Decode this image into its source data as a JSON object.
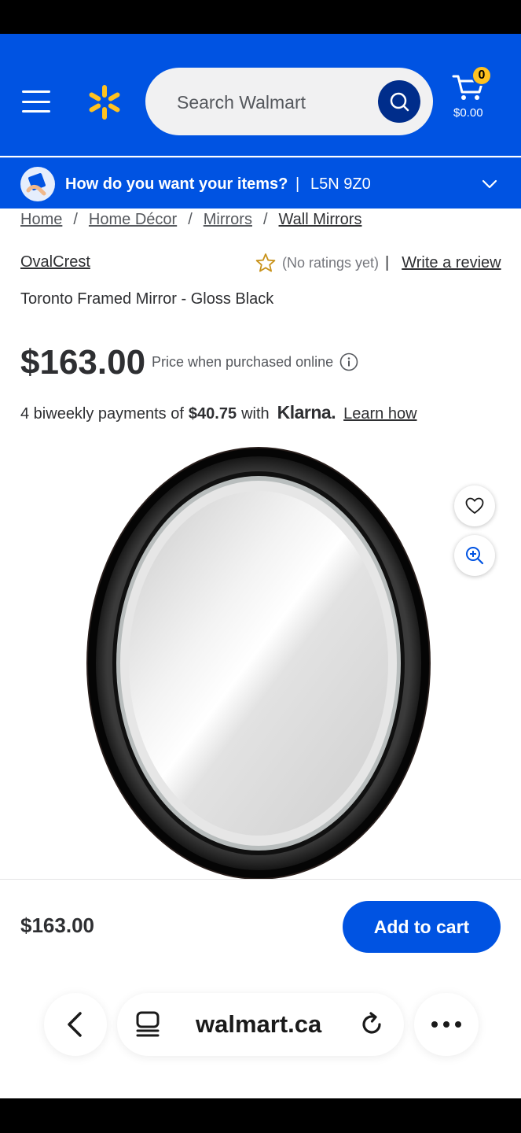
{
  "header": {
    "search_placeholder": "Search Walmart",
    "cart_count": "0",
    "cart_total": "$0.00",
    "brand_color": "#0053e2",
    "spark_color": "#ffc220"
  },
  "delivery": {
    "question": "How do you want your items?",
    "separator": "|",
    "postal_code": "L5N 9Z0"
  },
  "breadcrumb": {
    "items": [
      "Home",
      "Home Décor",
      "Mirrors",
      "Wall Mirrors"
    ],
    "separator": "/"
  },
  "product": {
    "brand": "OvalCrest",
    "rating_text": "(No ratings yet)",
    "rating_sep": "|",
    "review_link": "Write a review",
    "title": "Toronto Framed Mirror - Gloss Black",
    "price": "$163.00",
    "price_note": "Price when purchased online"
  },
  "klarna": {
    "prefix": "4 biweekly payments of",
    "amount": "$40.75",
    "with": "with",
    "logo": "Klarna.",
    "learn": "Learn how"
  },
  "sticky": {
    "price": "$163.00",
    "add_to_cart": "Add to cart"
  },
  "browser": {
    "url": "walmart.ca"
  }
}
